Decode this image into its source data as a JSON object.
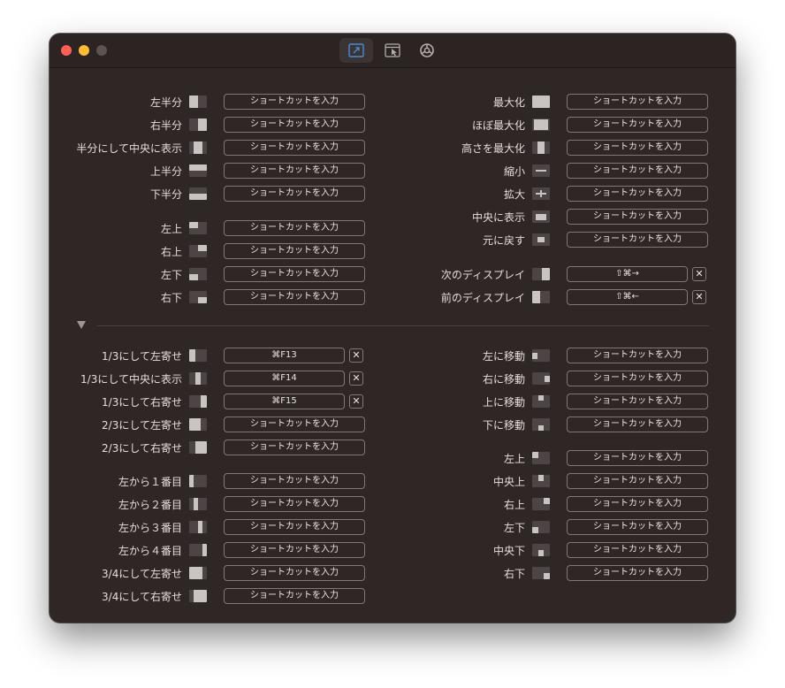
{
  "placeholder": "ショートカットを入力",
  "toolbar": {
    "tabs": [
      {
        "name": "keyboard-shortcuts-tab",
        "icon": "window-resize-icon",
        "active": true
      },
      {
        "name": "snap-areas-tab",
        "icon": "window-cursor-icon",
        "active": false
      },
      {
        "name": "general-settings-tab",
        "icon": "gear-icon",
        "active": false
      }
    ]
  },
  "colors": {
    "window": "#2f2726",
    "accent": "#4a8ad8",
    "icon_fill": "#c9c3c2"
  },
  "left_top": [
    {
      "label": "左半分",
      "icon": "left-half-icon",
      "shortcut": ""
    },
    {
      "label": "右半分",
      "icon": "right-half-icon",
      "shortcut": ""
    },
    {
      "label": "半分にして中央に表示",
      "icon": "center-half-icon",
      "shortcut": ""
    },
    {
      "label": "上半分",
      "icon": "top-half-icon",
      "shortcut": ""
    },
    {
      "label": "下半分",
      "icon": "bottom-half-icon",
      "shortcut": ""
    },
    {
      "label": "左上",
      "icon": "top-left-quarter-icon",
      "shortcut": ""
    },
    {
      "label": "右上",
      "icon": "top-right-quarter-icon",
      "shortcut": ""
    },
    {
      "label": "左下",
      "icon": "bottom-left-quarter-icon",
      "shortcut": ""
    },
    {
      "label": "右下",
      "icon": "bottom-right-quarter-icon",
      "shortcut": ""
    }
  ],
  "right_top": [
    {
      "label": "最大化",
      "icon": "maximize-icon",
      "shortcut": ""
    },
    {
      "label": "ほぼ最大化",
      "icon": "almost-maximize-icon",
      "shortcut": ""
    },
    {
      "label": "高さを最大化",
      "icon": "maximize-height-icon",
      "shortcut": ""
    },
    {
      "label": "縮小",
      "icon": "shrink-icon",
      "shortcut": ""
    },
    {
      "label": "拡大",
      "icon": "enlarge-icon",
      "shortcut": ""
    },
    {
      "label": "中央に表示",
      "icon": "center-icon",
      "shortcut": ""
    },
    {
      "label": "元に戻す",
      "icon": "restore-icon",
      "shortcut": ""
    },
    {
      "label": "次のディスプレイ",
      "icon": "next-display-icon",
      "shortcut": "⇧⌘→"
    },
    {
      "label": "前のディスプレイ",
      "icon": "previous-display-icon",
      "shortcut": "⇧⌘←"
    }
  ],
  "left_bottom": [
    {
      "label": "1/3にして左寄せ",
      "icon": "first-third-icon",
      "shortcut": "⌘F13"
    },
    {
      "label": "1/3にして中央に表示",
      "icon": "center-third-icon",
      "shortcut": "⌘F14"
    },
    {
      "label": "1/3にして右寄せ",
      "icon": "last-third-icon",
      "shortcut": "⌘F15"
    },
    {
      "label": "2/3にして左寄せ",
      "icon": "first-two-thirds-icon",
      "shortcut": ""
    },
    {
      "label": "2/3にして右寄せ",
      "icon": "last-two-thirds-icon",
      "shortcut": ""
    },
    {
      "label": "左から１番目",
      "icon": "first-fourth-icon",
      "shortcut": ""
    },
    {
      "label": "左から２番目",
      "icon": "second-fourth-icon",
      "shortcut": ""
    },
    {
      "label": "左から３番目",
      "icon": "third-fourth-icon",
      "shortcut": ""
    },
    {
      "label": "左から４番目",
      "icon": "last-fourth-icon",
      "shortcut": ""
    },
    {
      "label": "3/4にして左寄せ",
      "icon": "first-three-fourths-icon",
      "shortcut": ""
    },
    {
      "label": "3/4にして右寄せ",
      "icon": "last-three-fourths-icon",
      "shortcut": ""
    }
  ],
  "right_bottom": [
    {
      "label": "左に移動",
      "icon": "move-left-icon",
      "shortcut": ""
    },
    {
      "label": "右に移動",
      "icon": "move-right-icon",
      "shortcut": ""
    },
    {
      "label": "上に移動",
      "icon": "move-up-icon",
      "shortcut": ""
    },
    {
      "label": "下に移動",
      "icon": "move-down-icon",
      "shortcut": ""
    },
    {
      "label": "左上",
      "icon": "top-left-sixth-icon",
      "shortcut": ""
    },
    {
      "label": "中央上",
      "icon": "top-center-sixth-icon",
      "shortcut": ""
    },
    {
      "label": "右上",
      "icon": "top-right-sixth-icon",
      "shortcut": ""
    },
    {
      "label": "左下",
      "icon": "bottom-left-sixth-icon",
      "shortcut": ""
    },
    {
      "label": "中央下",
      "icon": "bottom-center-sixth-icon",
      "shortcut": ""
    },
    {
      "label": "右下",
      "icon": "bottom-right-sixth-icon",
      "shortcut": ""
    }
  ]
}
